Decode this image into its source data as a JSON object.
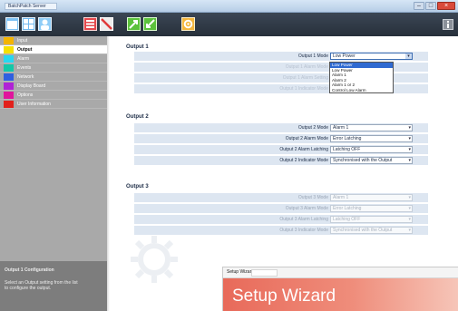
{
  "window": {
    "title": "BatchPatch Server",
    "controls": [
      "minimize-button",
      "maximize-button",
      "close-button"
    ]
  },
  "toolbar": {
    "icons": [
      "window-icon",
      "grid-icon",
      "user-icon",
      "list-icon",
      "cancel-icon",
      "export-icon",
      "import-icon",
      "gear-icon",
      "info-icon"
    ]
  },
  "sidebar": {
    "items": [
      {
        "label": "Input",
        "color": "#f4b400"
      },
      {
        "label": "Output",
        "color": "#f6e000"
      },
      {
        "label": "Alarm",
        "color": "#27d7f0"
      },
      {
        "label": "Events",
        "color": "#12c8a8"
      },
      {
        "label": "Network",
        "color": "#2f5fe0"
      },
      {
        "label": "Display Board",
        "color": "#b022d6"
      },
      {
        "label": "Options",
        "color": "#e0159c"
      },
      {
        "label": "User Information",
        "color": "#e2211c"
      }
    ],
    "footer": {
      "heading": "Output 1 Configuration",
      "lines": [
        "Select an Output setting from the list",
        "to configure the output."
      ]
    }
  },
  "output1": {
    "title": "Output 1",
    "rows": [
      {
        "label": "Output 1 Mode",
        "value": "Low Power"
      },
      {
        "label": "Output 1 Alarm Mode",
        "value": ""
      },
      {
        "label": "Output 1 Alarm Setting",
        "value": ""
      },
      {
        "label": "Output 1 Indicator Mode",
        "value": ""
      }
    ],
    "dropdown": [
      "Low Power",
      "Low Power",
      "Alarm 1",
      "Alarm 2",
      "Alarm 1 or 2",
      "Control Low Alarm"
    ],
    "dropdown_selected_index": 0
  },
  "output2": {
    "title": "Output 2",
    "rows": [
      {
        "label": "Output 2 Mode",
        "value": "Alarm 1"
      },
      {
        "label": "Output 2 Alarm Mode",
        "value": "Error Latching"
      },
      {
        "label": "Output 2 Alarm Latching",
        "value": "Latching OFF"
      },
      {
        "label": "Output 2 Indicator Mode",
        "value": "Synchronised with the Output"
      }
    ]
  },
  "output3": {
    "title": "Output 3",
    "rows": [
      {
        "label": "Output 3 Mode",
        "value": "Alarm 1"
      },
      {
        "label": "Output 3 Alarm Mode",
        "value": "Error Latching"
      },
      {
        "label": "Output 3 Alarm Latching",
        "value": "Latching OFF"
      },
      {
        "label": "Output 3 Indicator Mode",
        "value": "Synchronised with the Output"
      }
    ]
  },
  "wizard": {
    "window_title": "Setup Wizard",
    "banner": "Setup Wizard"
  },
  "colors": {
    "toolbar_bg": "#2d3642",
    "sidebar_bg": "#a9a9a9",
    "row_bg": "#dde6f1",
    "wizard_banner": "#e86a5a"
  }
}
